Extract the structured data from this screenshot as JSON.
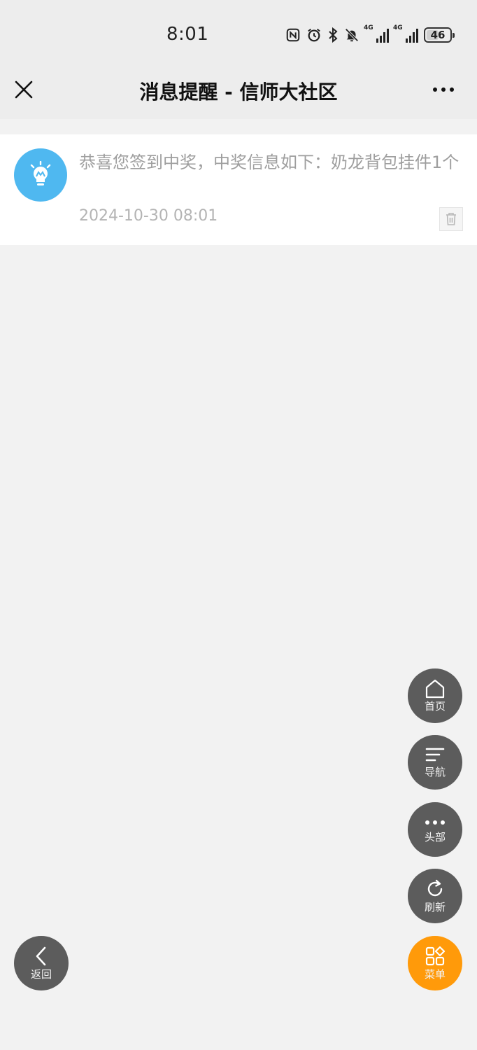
{
  "status_bar": {
    "time": "8:01",
    "signal1_label": "4G",
    "signal2_label": "4G",
    "battery": "46",
    "icons": [
      "nfc-icon",
      "alarm-icon",
      "bluetooth-icon",
      "mute-bell-icon",
      "signal-icon",
      "signal-icon",
      "battery-icon"
    ]
  },
  "nav": {
    "title": "消息提醒 - 信师大社区",
    "close_icon": "close-icon",
    "more_icon": "more-dots-icon"
  },
  "messages": [
    {
      "avatar_icon": "lightbulb-icon",
      "text": "恭喜您签到中奖，中奖信息如下：奶龙背包挂件1个",
      "time": "2024-10-30 08:01",
      "delete_icon": "trash-icon"
    }
  ],
  "colors": {
    "page_bg": "#f2f2f2",
    "header_bg": "#ededed",
    "avatar_bg": "#4fb8f0",
    "fab_bg": "#5c5c5c",
    "fab_menu_bg": "#ff9a0a"
  },
  "fabs": {
    "home": "首页",
    "nav": "导航",
    "head": "头部",
    "refresh": "刷新",
    "menu": "菜单",
    "back": "返回"
  }
}
